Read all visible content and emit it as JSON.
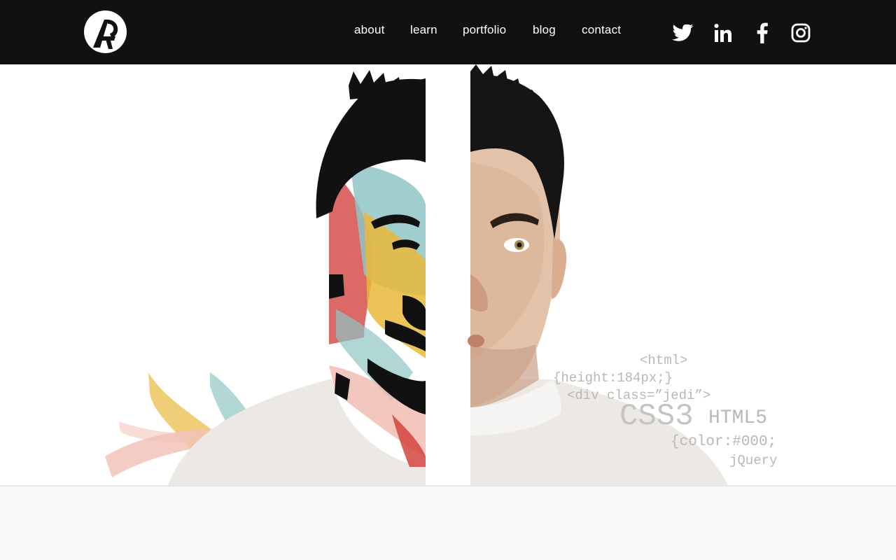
{
  "header": {
    "logo_icon": "ap-monogram-icon",
    "nav": [
      {
        "label": "about"
      },
      {
        "label": "learn"
      },
      {
        "label": "portfolio"
      },
      {
        "label": "blog"
      },
      {
        "label": "contact"
      }
    ],
    "social": [
      {
        "icon": "twitter-icon"
      },
      {
        "icon": "linkedin-icon"
      },
      {
        "icon": "facebook-icon"
      },
      {
        "icon": "instagram-icon"
      }
    ]
  },
  "hero": {
    "code_lines": [
      "<html>",
      "{height:184px;}",
      "<div class=”jedi”>",
      "CSS3",
      "HTML5",
      "{color:#000;",
      "jQuery"
    ]
  },
  "colors": {
    "header_bg": "#111111",
    "nav_text": "#ffffff",
    "paint_yellow": "#e9b83a",
    "paint_teal": "#8fc4c4",
    "paint_pink": "#f0b9ad",
    "paint_red": "#d2443e",
    "code_gray": "#b8b8b8"
  }
}
